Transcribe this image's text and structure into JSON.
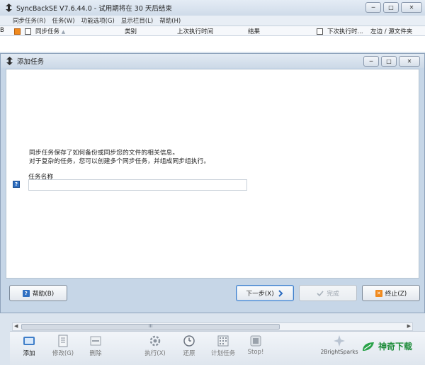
{
  "main_window": {
    "title": "SyncBackSE V7.6.44.0 - 试用期将在 30 天后结束",
    "menu": [
      "同步任务(R)",
      "任务(W)",
      "功能选项(G)",
      "显示栏目(L)",
      "帮助(H)"
    ],
    "columns": {
      "edge": "B",
      "name": "同步任务",
      "sort_indicator": "▲",
      "category": "类别",
      "last_run": "上次执行时间",
      "result": "结果",
      "next_run": "下次执行时...",
      "left_source": "左边 / 源文件夹"
    },
    "scroll_thumb": "III",
    "toolbar": [
      {
        "label": "添加",
        "icon": "add-task-icon",
        "active": true
      },
      {
        "label": "修改(G)",
        "icon": "edit-task-icon",
        "active": false
      },
      {
        "label": "删除",
        "icon": "delete-task-icon",
        "active": false
      },
      {
        "label": "执行(X)",
        "icon": "run-gear-icon",
        "active": false
      },
      {
        "label": "还原",
        "icon": "restore-clock-icon",
        "active": false
      },
      {
        "label": "计划任务",
        "icon": "schedule-grid-icon",
        "active": false
      },
      {
        "label": "Stop!",
        "icon": "stop-icon",
        "active": false
      }
    ],
    "brand": "2BrightSparks",
    "watermark": "神奇下载"
  },
  "dialog": {
    "title": "添加任务",
    "intro_line1": "同步任务保存了如何备份或同步您的文件的相关信息。",
    "intro_line2": "对于复杂的任务，您可以创建多个同步任务，并组成同步组执行。",
    "field_label": "任务名称",
    "task_name_value": "",
    "buttons": {
      "help": "帮助(B)",
      "next": "下一步(X)",
      "finish": "完成",
      "abort": "终止(Z)"
    }
  },
  "colors": {
    "accent_blue": "#3f7ec9",
    "abort_orange": "#f08a1e",
    "next_arrow": "#2c6cc0",
    "logo_green": "#1e8c3a"
  }
}
